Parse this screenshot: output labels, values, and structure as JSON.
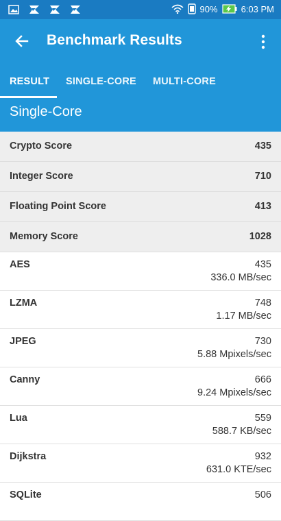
{
  "status_bar": {
    "battery_percent": "90%",
    "time": "6:03 PM",
    "icons": [
      "image-icon",
      "feather-app-icon",
      "feather-app-icon",
      "feather-app-icon",
      "wifi-icon",
      "phone-icon",
      "battery-charging-icon"
    ]
  },
  "app_bar": {
    "title": "Benchmark Results",
    "back_icon": "arrow-back-icon",
    "menu_icon": "more-vert-icon"
  },
  "tabs": [
    {
      "label": "RESULT",
      "active": true
    },
    {
      "label": "SINGLE-CORE",
      "active": false
    },
    {
      "label": "MULTI-CORE",
      "active": false
    }
  ],
  "section": {
    "title": "Single-Core"
  },
  "summary": [
    {
      "label": "Crypto Score",
      "value": "435"
    },
    {
      "label": "Integer Score",
      "value": "710"
    },
    {
      "label": "Floating Point Score",
      "value": "413"
    },
    {
      "label": "Memory Score",
      "value": "1028"
    }
  ],
  "details": [
    {
      "label": "AES",
      "score": "435",
      "rate": "336.0 MB/sec"
    },
    {
      "label": "LZMA",
      "score": "748",
      "rate": "1.17 MB/sec"
    },
    {
      "label": "JPEG",
      "score": "730",
      "rate": "5.88 Mpixels/sec"
    },
    {
      "label": "Canny",
      "score": "666",
      "rate": "9.24 Mpixels/sec"
    },
    {
      "label": "Lua",
      "score": "559",
      "rate": "588.7 KB/sec"
    },
    {
      "label": "Dijkstra",
      "score": "932",
      "rate": "631.0 KTE/sec"
    },
    {
      "label": "SQLite",
      "score": "506",
      "rate": ""
    }
  ],
  "colors": {
    "status_bar": "#1a7bc2",
    "primary": "#2196d9",
    "summary_bg": "#eeeeee",
    "text": "#333333"
  }
}
